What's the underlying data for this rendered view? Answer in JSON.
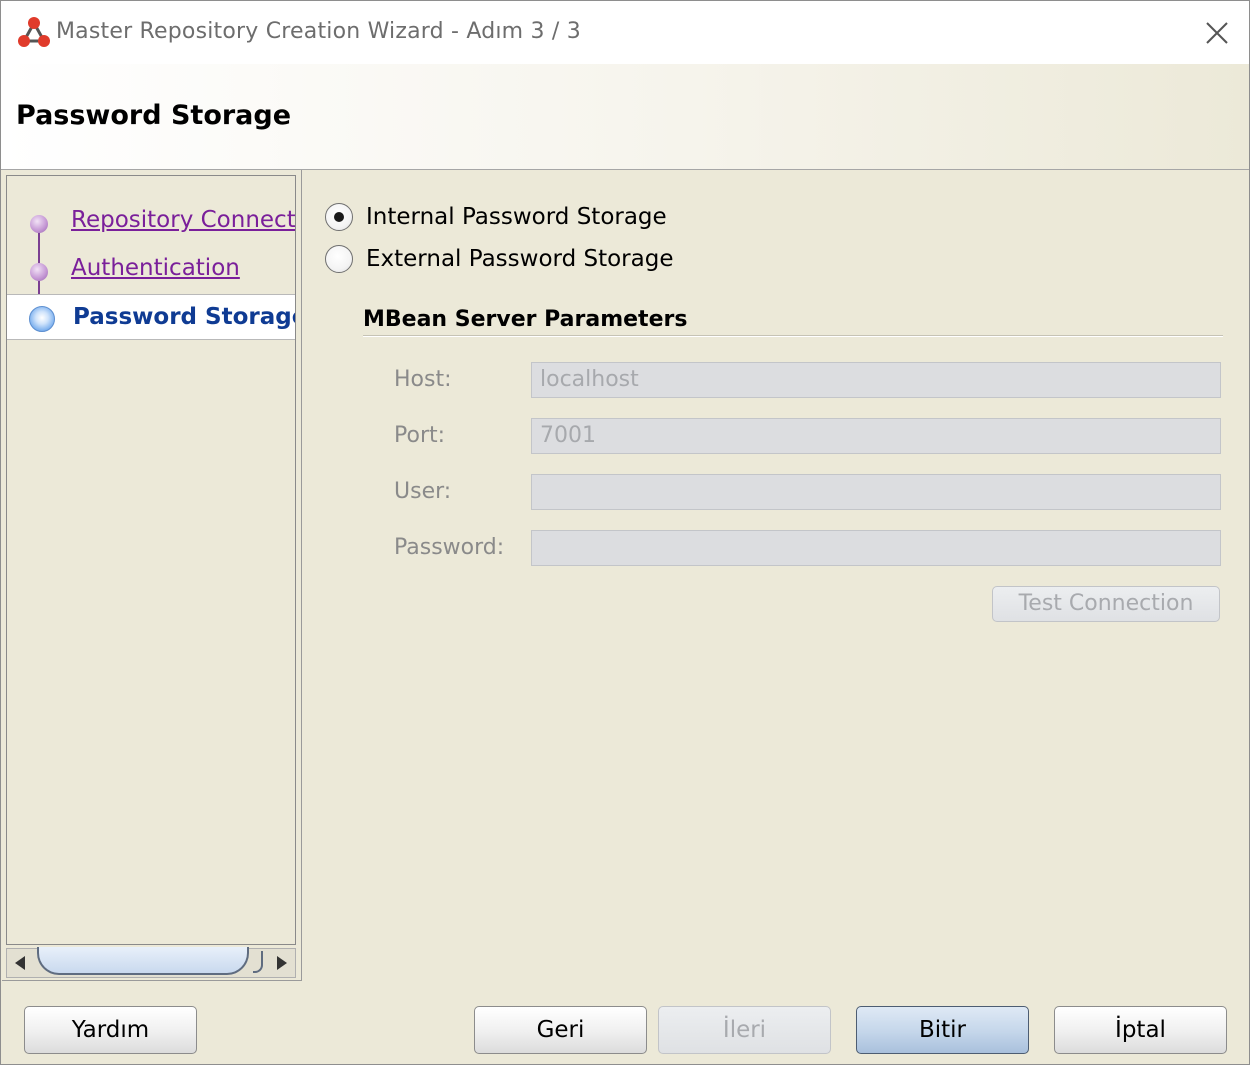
{
  "window": {
    "title": "Master Repository Creation Wizard - Adım 3 / 3",
    "icon": "odi-repository-icon",
    "close_icon": "close-icon"
  },
  "header": {
    "title": "Password Storage"
  },
  "nav": {
    "items": [
      {
        "label": "Repository Connectio",
        "state": "visited"
      },
      {
        "label": "Authentication",
        "state": "visited"
      },
      {
        "label": "Password Storage",
        "state": "current"
      }
    ]
  },
  "storage_options": {
    "internal_label": "Internal Password Storage",
    "external_label": "External Password Storage",
    "selected": "internal"
  },
  "mbean": {
    "section_title": "MBean Server Parameters",
    "host_label": "Host:",
    "host_value": "localhost",
    "port_label": "Port:",
    "port_value": "7001",
    "user_label": "User:",
    "user_value": "",
    "password_label": "Password:",
    "password_value": "",
    "test_connection_label": "Test Connection"
  },
  "footer": {
    "help_label": "Yardım",
    "back_label": "Geri",
    "next_label": "İleri",
    "finish_label": "Bitir",
    "cancel_label": "İptal"
  },
  "colors": {
    "panel_bg": "#ece9d8",
    "link_purple": "#7a1f9a",
    "selected_blue": "#0f3b93"
  }
}
